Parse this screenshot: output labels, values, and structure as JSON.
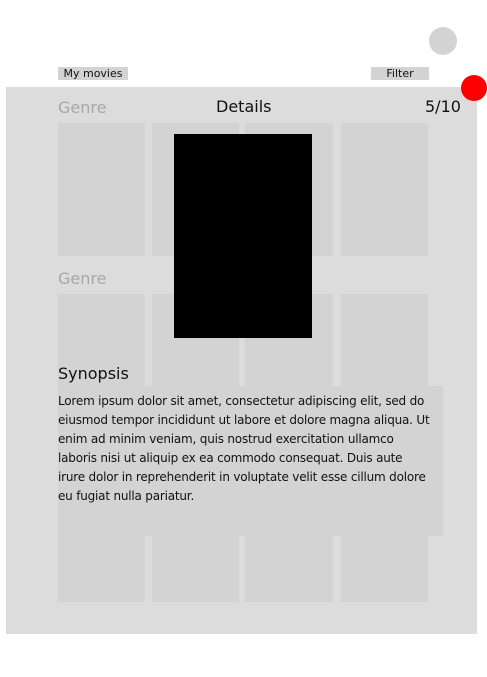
{
  "toolbar": {
    "my_movies_label": "My movies",
    "filter_label": "Filter"
  },
  "details": {
    "title": "Details",
    "rating": "5/10"
  },
  "sections": [
    {
      "label": "Genre"
    },
    {
      "label": "Genre"
    }
  ],
  "synopsis": {
    "heading": "Synopsis",
    "text": "Lorem ipsum dolor sit amet, consectetur adipiscing elit, sed do eiusmod tempor incididunt ut labore et dolore magna aliqua. Ut enim ad minim veniam, quis nostrud exercitation ullamco laboris nisi ut aliquip ex ea commodo consequat. Duis aute irure dolor in reprehenderit in voluptate velit esse cillum dolore eu fugiat nulla pariatur."
  },
  "colors": {
    "panel": "#dcdcdc",
    "tile": "#d3d3d3",
    "close_dot": "#ff0000",
    "avatar": "#d3d3d3",
    "poster": "#000000"
  }
}
